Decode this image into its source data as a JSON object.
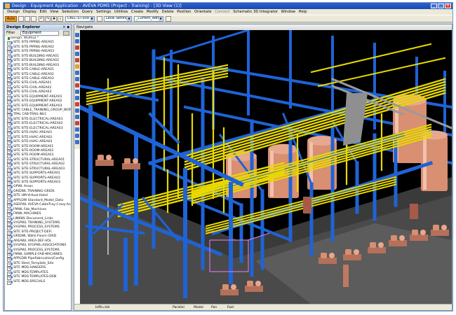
{
  "window": {
    "title": "Design - Equipment Application - AVEVA PDMS (Project - Training) - [3D View (1)]"
  },
  "menu": [
    "Design",
    "Display",
    "Edit",
    "View",
    "Selection",
    "Query",
    "Settings",
    "Utilities",
    "Create",
    "Modify",
    "Delete",
    "Position",
    "Orientate",
    "Connect",
    "Schematic 3D Integrator",
    "Window",
    "Help"
  ],
  "toolbar": {
    "mode_label": "Auto",
    "element_combo": "CBLC-ST-009",
    "settings_combo": "Local Settings",
    "current_combo": "_Current_Admi"
  },
  "explorer": {
    "title": "Design Explorer",
    "filter_label": "Filter",
    "filter_value": "Equipment",
    "items": [
      "Design: WORLD *",
      "SITE SITE-PIPING-AREA01",
      "SITE SITE-PIPING-AREA02",
      "SITE SITE-PIPING-AREA03",
      "SITE SITE-BUILDING-AREA01",
      "SITE SITE-BUILDING-AREA02",
      "SITE SITE-BUILDING-AREA03",
      "SITE SITE-CABLE-AREA01",
      "SITE SITE-CABLE-AREA02",
      "SITE SITE-CABLE-AREA03",
      "SITE SITE-CIVIL-AREA01",
      "SITE SITE-CIVIL-AREA02",
      "SITE SITE-CIVIL-AREA03",
      "SITE SITE-EQUIPMENT-AREA01",
      "SITE SITE-EQUIPMENT-AREA02",
      "SITE SITE-EQUIPMENT-AREA03",
      "SITE CABLE_TRAINING_GROUP_WORLD",
      "TPAL CAB-TRAIL-NU1",
      "SITE SITE-ELECTRICAL-AREA01",
      "SITE SITE-ELECTRICAL-AREA02",
      "SITE SITE-ELECTRICAL-AREA03",
      "SITE SITE-HVAC-AREA01",
      "SITE SITE-HVAC-AREA02",
      "SITE SITE-HVAC-AREA03",
      "SITE SITE-ROOM-AREA01",
      "SITE SITE-ROOM-AREA02",
      "SITE SITE-ROOM-AREA03",
      "SITE SITE-STRUCTURAL-AREA01",
      "SITE SITE-STRUCTURAL-AREA02",
      "SITE SITE-STRUCTURAL-AREA03",
      "SITE SITE-SUPPORTS-AREA01",
      "SITE SITE-SUPPORTS-AREA02",
      "SITE SITE-SUPPORTS-AREA03",
      "GPWL Areas",
      "GRIDWL TRAINING-GRIDS",
      "SITE HM-Virtual-Hotel",
      "APPLDW Standard_Model_Data",
      "ASDFWL AVEVA-CableTray-Crazy-Associated",
      "FMWL Fab_Machines",
      "FMWL MACHINES",
      "LINKWL Document_Links",
      "SYGPWL TRAINING_SYSTEMS",
      "SYGPWL PROCESS_SYSTEMS",
      "SITE SITE-PROJECT-DEFI",
      "GRIDWL Walls-Floors-GRID",
      "AREAWL AREA-DEF-VOL",
      "SYGPWL SYGPWL-ASSOCIATIONS",
      "SYGPWL PROCESS_SYSTEMS",
      "FMWL SAMPLE-FAB-MACHINES",
      "APPLDW PipeFabrication/Config",
      "SITE Steel_Template_Site",
      "SITE MDS-HANGERS",
      "SITE MDS-TEMPLATES",
      "SITE MDS-TEMPLATES-DSN",
      "SITE MDS-SPECIALS"
    ]
  },
  "view": {
    "title": "Navigate",
    "status": [
      "Infill=Vol",
      "Parallel",
      "Model",
      "Pan",
      "Fast"
    ]
  },
  "colors": {
    "steel": "#1f63d6",
    "pipe": "#e8d800",
    "equipment": "#d88f72",
    "background": "#000000",
    "titlebar": "#2a62d4"
  }
}
